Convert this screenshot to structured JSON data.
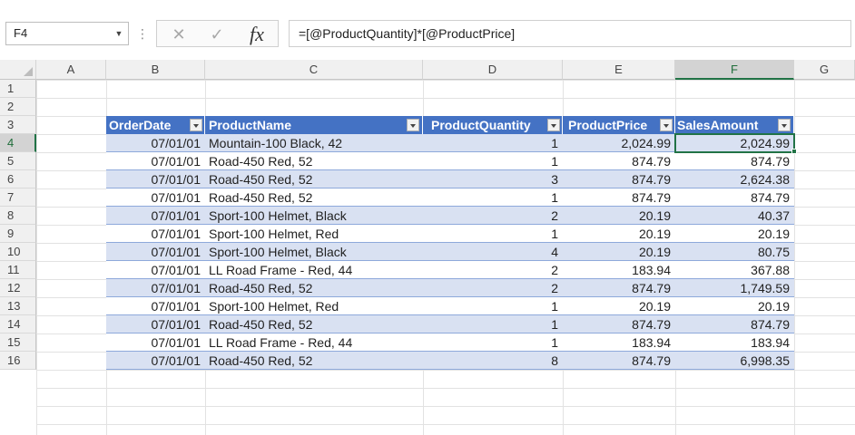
{
  "name_box": {
    "value": "F4"
  },
  "formula_bar": {
    "separator": "⋮",
    "cancel_glyph": "✕",
    "enter_glyph": "✓",
    "fx_label": "fx",
    "formula": "=[@ProductQuantity]*[@ProductPrice]"
  },
  "columns": [
    "A",
    "B",
    "C",
    "D",
    "E",
    "F",
    "G"
  ],
  "rows": [
    "1",
    "2",
    "3",
    "4",
    "5",
    "6",
    "7",
    "8",
    "9",
    "10",
    "11",
    "12",
    "13",
    "14",
    "15",
    "16"
  ],
  "active_cell": {
    "column": "F",
    "row": "4"
  },
  "table": {
    "headers": [
      "OrderDate",
      "ProductName",
      "ProductQuantity",
      "ProductPrice",
      "SalesAmount"
    ],
    "style_color": "#4472c4",
    "band_color": "#d9e1f2",
    "rows": [
      [
        "07/01/01",
        "Mountain-100 Black, 42",
        "1",
        "2,024.99",
        "2,024.99"
      ],
      [
        "07/01/01",
        "Road-450 Red, 52",
        "1",
        "874.79",
        "874.79"
      ],
      [
        "07/01/01",
        "Road-450 Red, 52",
        "3",
        "874.79",
        "2,624.38"
      ],
      [
        "07/01/01",
        "Road-450 Red, 52",
        "1",
        "874.79",
        "874.79"
      ],
      [
        "07/01/01",
        "Sport-100 Helmet, Black",
        "2",
        "20.19",
        "40.37"
      ],
      [
        "07/01/01",
        "Sport-100 Helmet, Red",
        "1",
        "20.19",
        "20.19"
      ],
      [
        "07/01/01",
        "Sport-100 Helmet, Black",
        "4",
        "20.19",
        "80.75"
      ],
      [
        "07/01/01",
        "LL Road Frame - Red, 44",
        "2",
        "183.94",
        "367.88"
      ],
      [
        "07/01/01",
        "Road-450 Red, 52",
        "2",
        "874.79",
        "1,749.59"
      ],
      [
        "07/01/01",
        "Sport-100 Helmet, Red",
        "1",
        "20.19",
        "20.19"
      ],
      [
        "07/01/01",
        "Road-450 Red, 52",
        "1",
        "874.79",
        "874.79"
      ],
      [
        "07/01/01",
        "LL Road Frame - Red, 44",
        "1",
        "183.94",
        "183.94"
      ],
      [
        "07/01/01",
        "Road-450 Red, 52",
        "8",
        "874.79",
        "6,998.35"
      ]
    ]
  }
}
